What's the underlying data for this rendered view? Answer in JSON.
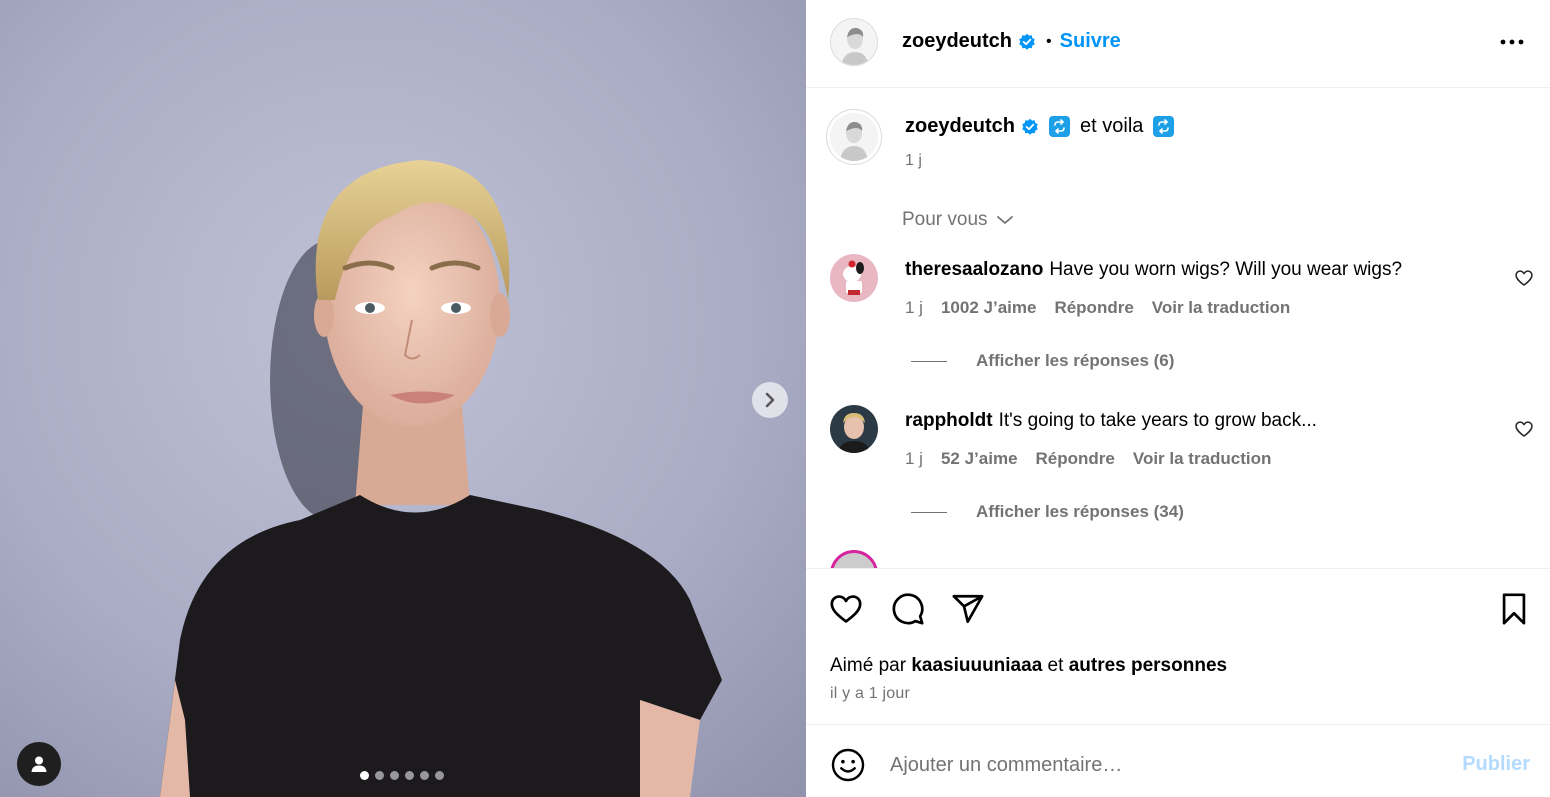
{
  "post": {
    "username": "zoeydeutch",
    "follow_label": "Suivre",
    "separator": "•",
    "verified_icon": "verified-badge-icon",
    "colors": {
      "accent": "#0095f6",
      "secondary_text": "#737373",
      "border": "#efefef"
    }
  },
  "media": {
    "carousel_total": 6,
    "carousel_active": 1
  },
  "caption": {
    "username": "zoeydeutch",
    "text": "et voila",
    "time": "1 j"
  },
  "sort": {
    "label": "Pour vous"
  },
  "comments": [
    {
      "username": "theresaalozano",
      "text": "Have you worn wigs? Will you wear wigs?",
      "time": "1 j",
      "likes": "1002 J’aime",
      "reply": "Répondre",
      "translate": "Voir la traduction",
      "replies": "Afficher les réponses (6)"
    },
    {
      "username": "rappholdt",
      "text": "It's going to take years to grow back...",
      "time": "1 j",
      "likes": "52 J’aime",
      "reply": "Répondre",
      "translate": "Voir la traduction",
      "replies": "Afficher les réponses (34)"
    }
  ],
  "likes": {
    "prefix": "Aimé par",
    "user": "kaasiuuuniaaa",
    "joiner": "et",
    "others": "autres personnes",
    "time": "il y a 1 jour"
  },
  "add_comment": {
    "placeholder": "Ajouter un commentaire…",
    "publish": "Publier"
  }
}
